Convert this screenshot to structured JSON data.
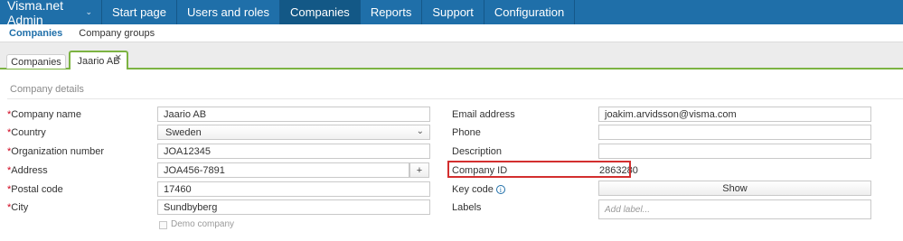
{
  "topnav": {
    "brand": "Visma.net Admin",
    "items": [
      "Start page",
      "Users and roles",
      "Companies",
      "Reports",
      "Support",
      "Configuration"
    ],
    "active_index": 2,
    "color": "#1f6fa9"
  },
  "subnav": {
    "items": [
      "Companies",
      "Company groups"
    ],
    "active_index": 0
  },
  "tabs": {
    "items": [
      {
        "label": "Companies"
      },
      {
        "label": "Jaario AB",
        "close": "✕"
      }
    ],
    "active_index": 1
  },
  "section_title": "Company details",
  "left_fields": [
    {
      "label": "Company name",
      "required": "*",
      "value": "Jaario AB"
    },
    {
      "label": "Country",
      "required": "*",
      "value": "Sweden"
    },
    {
      "label": "Organization number",
      "required": "*",
      "value": "JOA12345"
    },
    {
      "label": "Address",
      "required": "*",
      "value": "JOA456-7891",
      "button": "+"
    },
    {
      "label": "Postal code",
      "required": "*",
      "value": "17460"
    },
    {
      "label": "City",
      "required": "*",
      "value": "Sundbyberg"
    }
  ],
  "demo_company": {
    "label": "Demo company",
    "checked": false
  },
  "right_fields": {
    "email": {
      "label": "Email address",
      "value": "joakim.arvidsson@visma.com"
    },
    "phone": {
      "label": "Phone",
      "value": ""
    },
    "description": {
      "label": "Description",
      "value": ""
    },
    "company_id": {
      "label": "Company ID",
      "value": "2863280"
    },
    "key_code": {
      "label": "Key code",
      "button": "Show"
    },
    "labels": {
      "label": "Labels",
      "placeholder": "Add label..."
    }
  }
}
